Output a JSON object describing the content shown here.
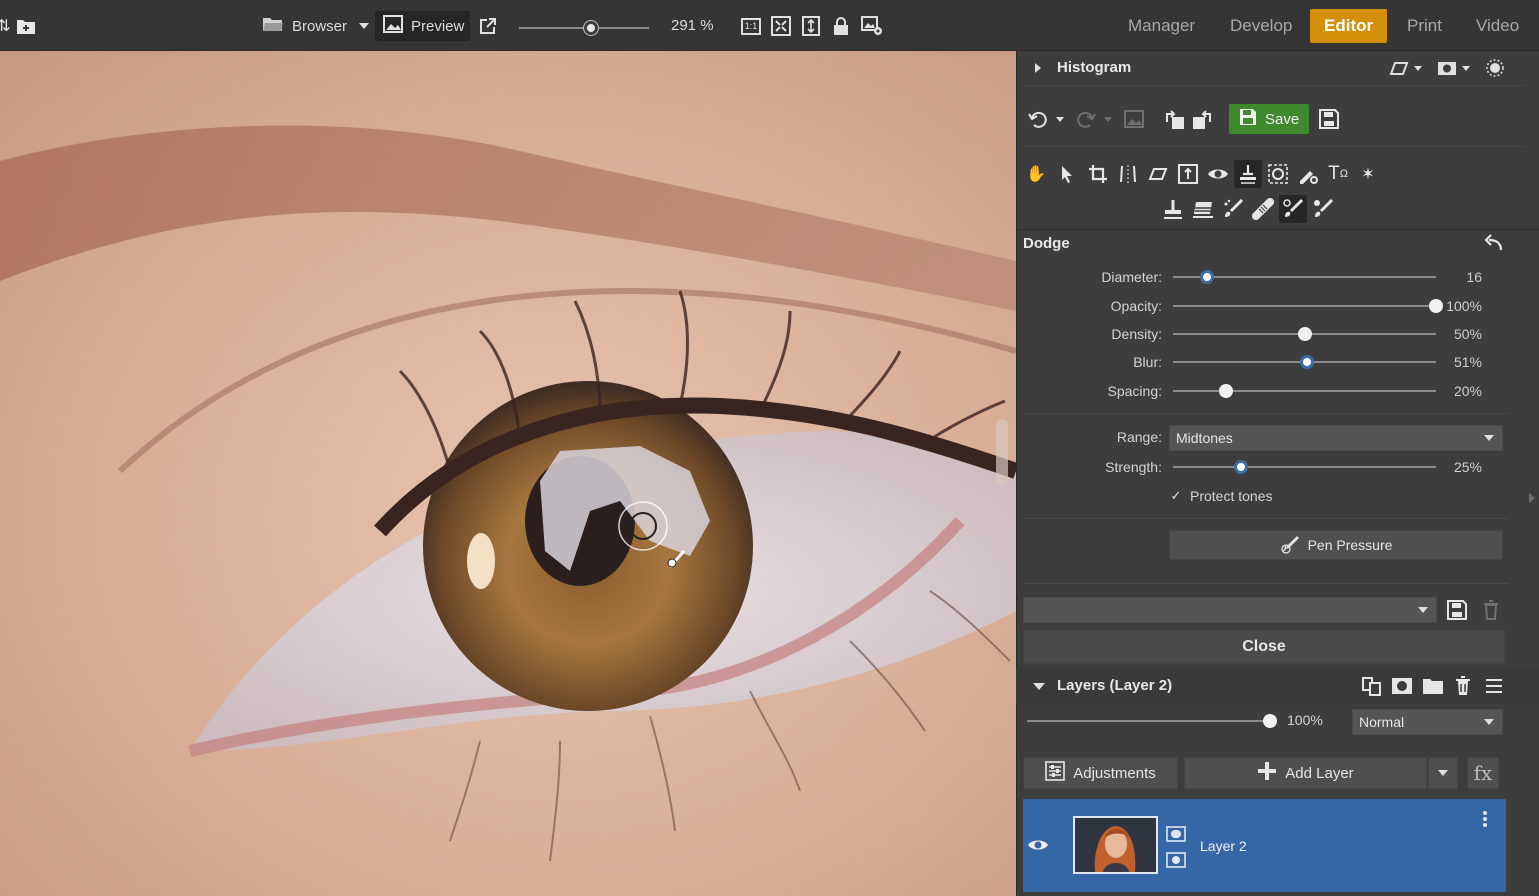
{
  "topbar": {
    "browser_label": "Browser",
    "preview_label": "Preview",
    "zoom_value": "291 %",
    "zoom_level_fraction": 0.55,
    "modes": [
      "Manager",
      "Develop",
      "Editor",
      "Print",
      "Video"
    ],
    "active_mode": "Editor",
    "ratio_label": "1:1"
  },
  "histogram": {
    "title": "Histogram"
  },
  "toolbar": {
    "save_label": "Save"
  },
  "tool": {
    "name": "Dodge",
    "sliders": [
      {
        "label": "Diameter:",
        "value": "16",
        "fraction": 0.13
      },
      {
        "label": "Opacity:",
        "value": "100%",
        "fraction": 1.0
      },
      {
        "label": "Density:",
        "value": "50%",
        "fraction": 0.5
      },
      {
        "label": "Blur:",
        "value": "51%",
        "fraction": 0.51
      },
      {
        "label": "Spacing:",
        "value": "20%",
        "fraction": 0.2
      }
    ],
    "range_label": "Range:",
    "range_value": "Midtones",
    "strength": {
      "label": "Strength:",
      "value": "25%",
      "fraction": 0.26
    },
    "protect_tones_label": "Protect tones",
    "protect_tones_checked": true,
    "pen_pressure_label": "Pen Pressure",
    "preset_value": "",
    "close_label": "Close"
  },
  "layers": {
    "title": "Layers (Layer 2)",
    "opacity_value": "100%",
    "opacity_fraction": 1.0,
    "blend_mode": "Normal",
    "adjustments_label": "Adjustments",
    "add_layer_label": "Add Layer",
    "fx_label": "fx",
    "items": [
      {
        "name": "Layer 2",
        "visible": true,
        "selected": true
      }
    ]
  },
  "colors": {
    "accent_editor": "#d4900a",
    "save_green": "#3f8a2e",
    "selection_blue": "#3567a6"
  },
  "icons": {
    "top": [
      "folder-icon",
      "preview-icon",
      "external-link-icon",
      "actual-size-icon",
      "fit-icon",
      "fit-height-icon",
      "lock-icon",
      "settings-image-icon"
    ],
    "tools_row1": [
      "hand-icon",
      "pointer-icon",
      "crop-icon",
      "straighten-icon",
      "perspective-icon",
      "resize-icon",
      "red-eye-icon",
      "dodge-burn-icon",
      "selection-icon",
      "clone-icon",
      "text-icon",
      "sparkle-icon"
    ],
    "tools_row2": [
      "stamp-icon",
      "eraser-icon",
      "brush-icon",
      "bandage-icon",
      "dodge-icon",
      "burn-icon"
    ]
  }
}
